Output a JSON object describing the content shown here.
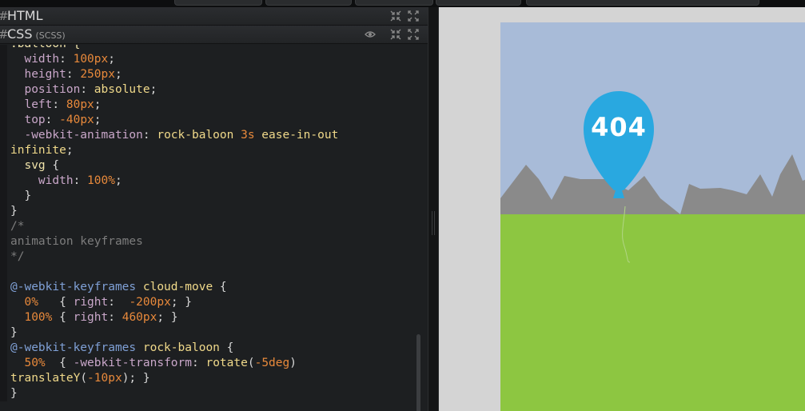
{
  "editor": {
    "html_pane": {
      "title": "HTML",
      "hash": "#"
    },
    "css_pane": {
      "title": "CSS",
      "subtitle": "(SCSS)",
      "hash": "#"
    },
    "code_lines": [
      [
        [
          "t-sel",
          ".balloon {"
        ]
      ],
      [
        [
          "t-pn",
          "  "
        ],
        [
          "t-prop",
          "width"
        ],
        [
          "t-pn",
          ": "
        ],
        [
          "t-val",
          "100px"
        ],
        [
          "t-pn",
          ";"
        ]
      ],
      [
        [
          "t-pn",
          "  "
        ],
        [
          "t-prop",
          "height"
        ],
        [
          "t-pn",
          ": "
        ],
        [
          "t-val",
          "250px"
        ],
        [
          "t-pn",
          ";"
        ]
      ],
      [
        [
          "t-pn",
          "  "
        ],
        [
          "t-prop",
          "position"
        ],
        [
          "t-pn",
          ": "
        ],
        [
          "t-kw",
          "absolute"
        ],
        [
          "t-pn",
          ";"
        ]
      ],
      [
        [
          "t-pn",
          "  "
        ],
        [
          "t-prop",
          "left"
        ],
        [
          "t-pn",
          ": "
        ],
        [
          "t-val",
          "80px"
        ],
        [
          "t-pn",
          ";"
        ]
      ],
      [
        [
          "t-pn",
          "  "
        ],
        [
          "t-prop",
          "top"
        ],
        [
          "t-pn",
          ": "
        ],
        [
          "t-val",
          "-40px"
        ],
        [
          "t-pn",
          ";"
        ]
      ],
      [
        [
          "t-pn",
          "  "
        ],
        [
          "t-prop",
          "-webkit-animation"
        ],
        [
          "t-pn",
          ": "
        ],
        [
          "t-kw",
          "rock-baloon "
        ],
        [
          "t-val",
          "3s"
        ],
        [
          "t-kw",
          " ease-in-out"
        ]
      ],
      [
        [
          "t-kw",
          "infinite"
        ],
        [
          "t-pn",
          ";"
        ]
      ],
      [
        [
          "t-pn",
          "  "
        ],
        [
          "t-sel",
          "svg"
        ],
        [
          "t-pn",
          " {"
        ]
      ],
      [
        [
          "t-pn",
          "    "
        ],
        [
          "t-prop",
          "width"
        ],
        [
          "t-pn",
          ": "
        ],
        [
          "t-val",
          "100%"
        ],
        [
          "t-pn",
          ";"
        ]
      ],
      [
        [
          "t-pn",
          "  }"
        ]
      ],
      [
        [
          "t-pn",
          "}"
        ]
      ],
      [
        [
          "t-cm",
          "/*"
        ]
      ],
      [
        [
          "t-cm",
          "animation keyframes"
        ]
      ],
      [
        [
          "t-cm",
          "*/"
        ]
      ],
      [
        [
          "t-pn",
          ""
        ]
      ],
      [
        [
          "t-at",
          "@-webkit-keyframes"
        ],
        [
          "t-kw",
          " cloud-move"
        ],
        [
          "t-pn",
          " {"
        ]
      ],
      [
        [
          "t-pn",
          "  "
        ],
        [
          "t-val",
          "0%"
        ],
        [
          "t-pn",
          "   { "
        ],
        [
          "t-prop",
          "right"
        ],
        [
          "t-pn",
          ":  "
        ],
        [
          "t-val",
          "-200px"
        ],
        [
          "t-pn",
          "; }"
        ]
      ],
      [
        [
          "t-pn",
          "  "
        ],
        [
          "t-val",
          "100%"
        ],
        [
          "t-pn",
          " { "
        ],
        [
          "t-prop",
          "right"
        ],
        [
          "t-pn",
          ": "
        ],
        [
          "t-val",
          "460px"
        ],
        [
          "t-pn",
          "; }"
        ]
      ],
      [
        [
          "t-pn",
          "}"
        ]
      ],
      [
        [
          "t-at",
          "@-webkit-keyframes"
        ],
        [
          "t-kw",
          " rock-baloon"
        ],
        [
          "t-pn",
          " {"
        ]
      ],
      [
        [
          "t-pn",
          "  "
        ],
        [
          "t-val",
          "50%"
        ],
        [
          "t-pn",
          "  { "
        ],
        [
          "t-prop",
          "-webkit-transform"
        ],
        [
          "t-pn",
          ": "
        ],
        [
          "t-kw",
          "rotate"
        ],
        [
          "t-pn",
          "("
        ],
        [
          "t-val",
          "-5deg"
        ],
        [
          "t-pn",
          ")"
        ]
      ],
      [
        [
          "t-kw",
          "translateY"
        ],
        [
          "t-pn",
          "("
        ],
        [
          "t-val",
          "-10px"
        ],
        [
          "t-pn",
          "); }"
        ]
      ],
      [
        [
          "t-pn",
          "}"
        ]
      ]
    ]
  },
  "preview": {
    "balloon_text": "404",
    "colors": {
      "sky": "#a8bbd8",
      "grass": "#8dc641",
      "mountain": "#8a8a8a",
      "balloon": "#29a8e0"
    }
  }
}
